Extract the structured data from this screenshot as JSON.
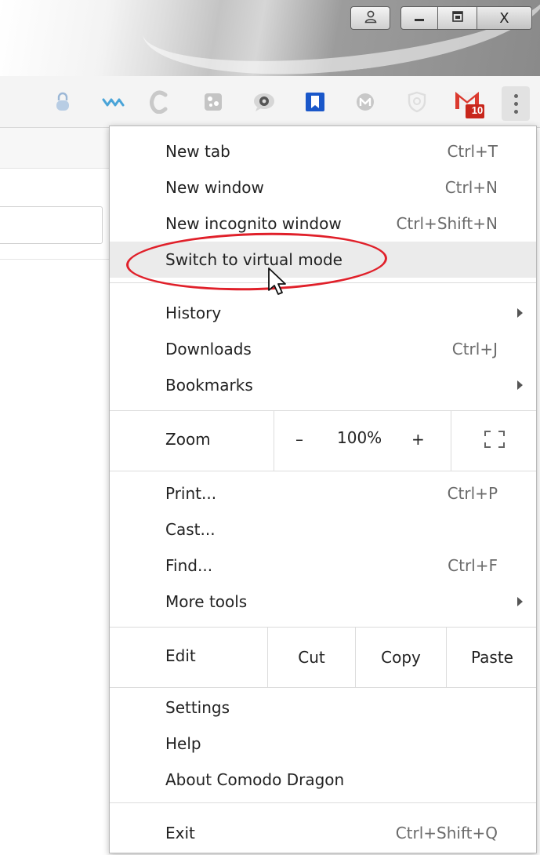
{
  "window": {
    "buttons": {
      "profile_icon": "user-icon",
      "minimize_icon": "minimize-icon",
      "maximize_icon": "maximize-icon",
      "close_label": "X"
    }
  },
  "toolbar": {
    "extensions": [
      {
        "icon": "padlock-extension-icon"
      },
      {
        "icon": "wave-extension-icon"
      },
      {
        "icon": "c-extension-icon"
      },
      {
        "icon": "puzzle-extension-icon"
      },
      {
        "icon": "eye-chat-extension-icon"
      },
      {
        "icon": "bookmark-extension-icon"
      },
      {
        "icon": "m-extension-icon"
      },
      {
        "icon": "shield-extension-icon"
      },
      {
        "icon": "gmail-extension-icon",
        "badge": "10"
      }
    ],
    "menu_icon": "kebab-menu-icon"
  },
  "menu": {
    "new_tab": {
      "label": "New tab",
      "shortcut": "Ctrl+T"
    },
    "new_window": {
      "label": "New window",
      "shortcut": "Ctrl+N"
    },
    "new_incognito": {
      "label": "New incognito window",
      "shortcut": "Ctrl+Shift+N"
    },
    "virtual_mode": {
      "label": "Switch to virtual mode"
    },
    "history": {
      "label": "History"
    },
    "downloads": {
      "label": "Downloads",
      "shortcut": "Ctrl+J"
    },
    "bookmarks": {
      "label": "Bookmarks"
    },
    "zoom": {
      "label": "Zoom",
      "minus": "–",
      "value": "100%",
      "plus": "+"
    },
    "print": {
      "label": "Print...",
      "shortcut": "Ctrl+P"
    },
    "cast": {
      "label": "Cast..."
    },
    "find": {
      "label": "Find...",
      "shortcut": "Ctrl+F"
    },
    "more_tools": {
      "label": "More tools"
    },
    "edit": {
      "label": "Edit",
      "cut": "Cut",
      "copy": "Copy",
      "paste": "Paste"
    },
    "settings": {
      "label": "Settings"
    },
    "help": {
      "label": "Help"
    },
    "about": {
      "label": "About Comodo Dragon"
    },
    "exit": {
      "label": "Exit",
      "shortcut": "Ctrl+Shift+Q"
    }
  },
  "colors": {
    "annotation": "#e0202a",
    "highlight": "#ebebeb",
    "bookmark_blue": "#1a57c9",
    "gmail_red": "#db3a2f"
  }
}
